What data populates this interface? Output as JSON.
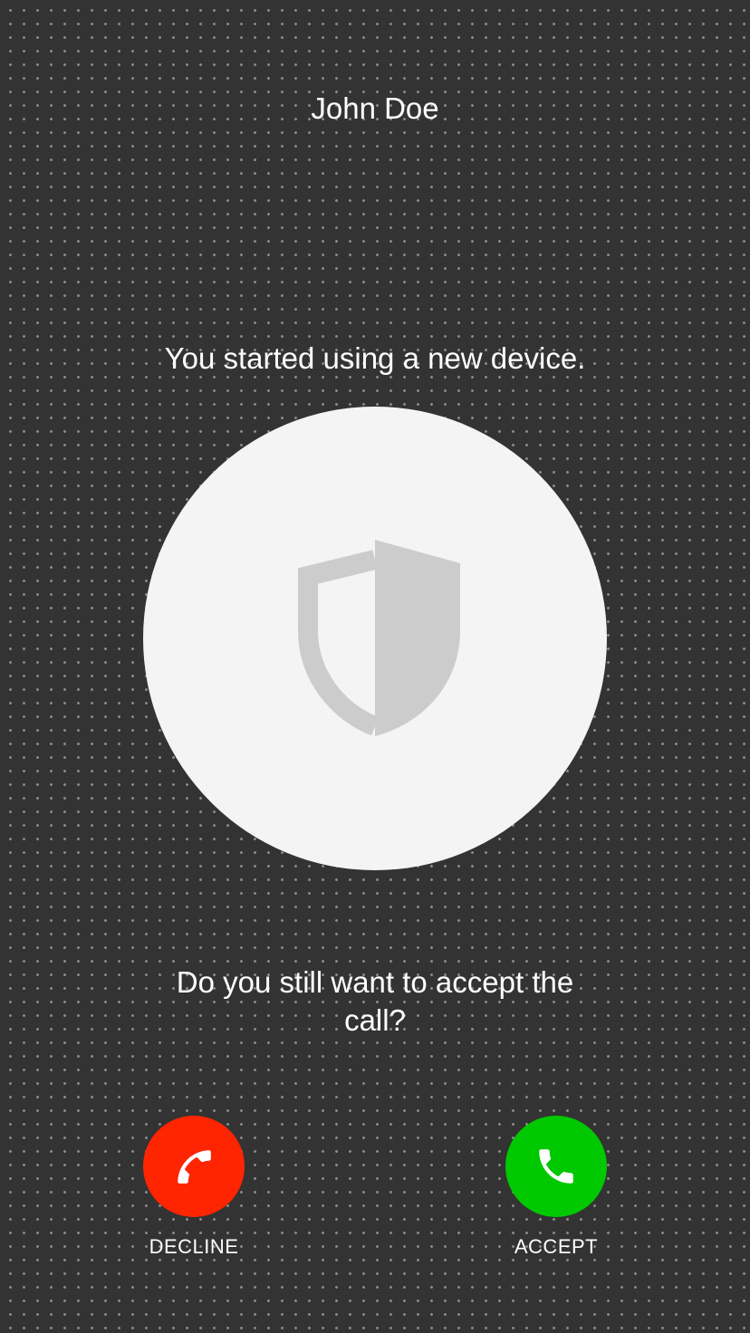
{
  "call": {
    "caller_name": "John Doe",
    "warning": "You started using a new device.",
    "question": "Do you still want to accept the call?"
  },
  "icons": {
    "center": "shield-icon",
    "decline": "phone-hangup-icon",
    "accept": "phone-icon"
  },
  "actions": {
    "decline_label": "DECLINE",
    "accept_label": "ACCEPT"
  },
  "colors": {
    "background": "#333333",
    "circle": "#f4f4f4",
    "shield": "#cccccc",
    "decline": "#ff2500",
    "accept": "#00c800"
  }
}
